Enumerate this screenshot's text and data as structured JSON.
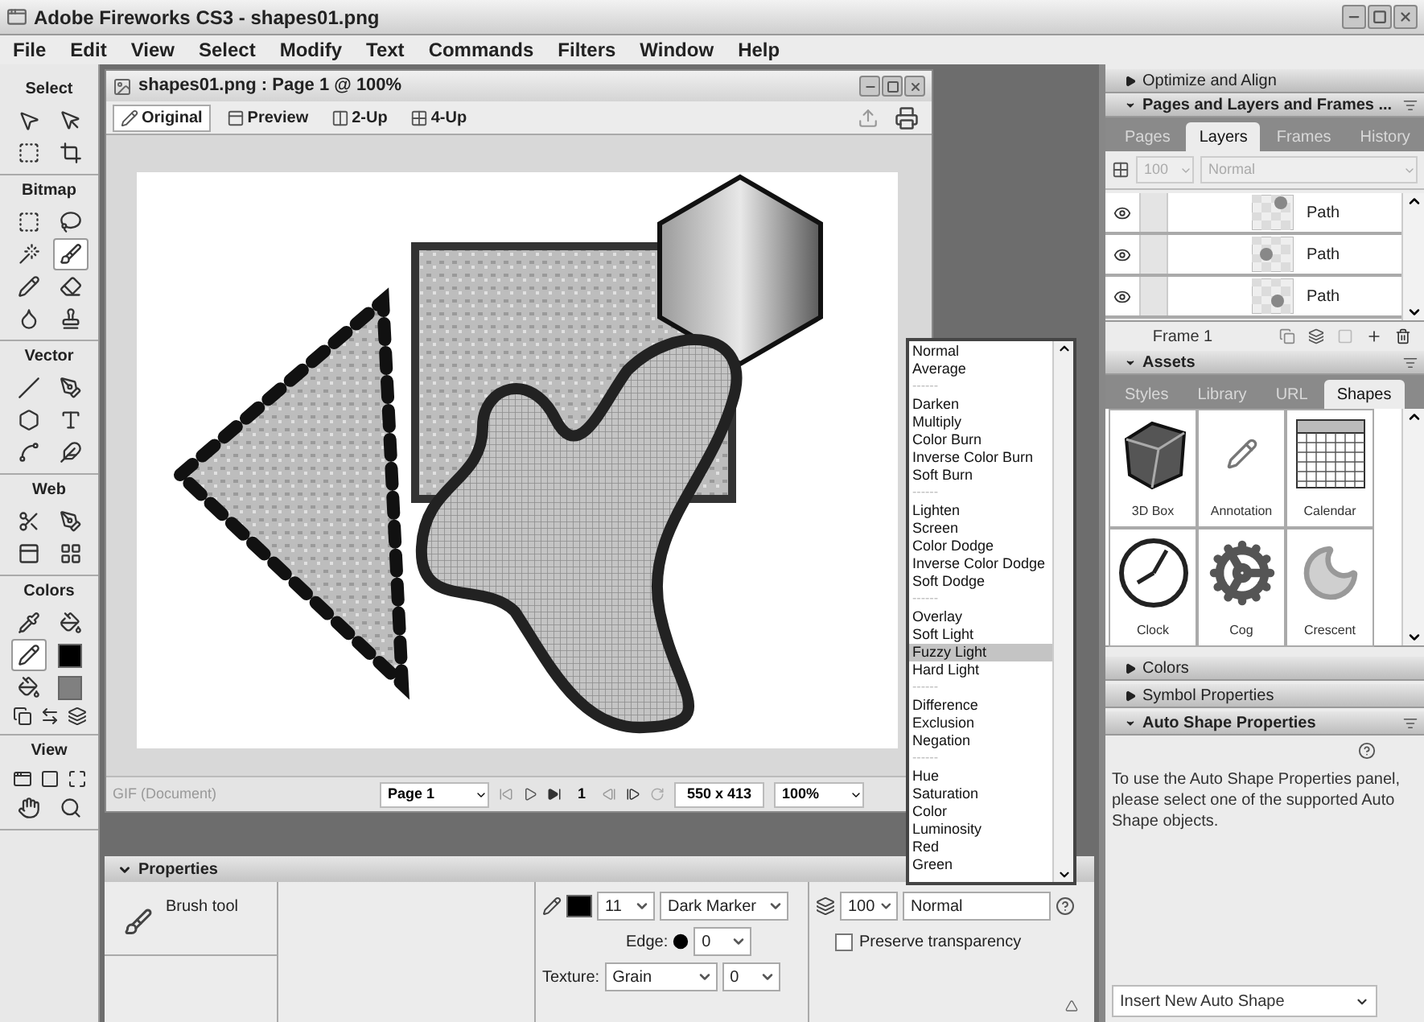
{
  "window": {
    "title": "Adobe Fireworks CS3 - shapes01.png"
  },
  "menu": [
    "File",
    "Edit",
    "View",
    "Select",
    "Modify",
    "Text",
    "Commands",
    "Filters",
    "Window",
    "Help"
  ],
  "tools_panel": [
    {
      "title": "Select",
      "tools": [
        {
          "kind": "tool",
          "selected": false
        },
        {
          "kind": "tool",
          "selected": false
        },
        {
          "kind": "tool",
          "selected": false
        },
        {
          "kind": "tool",
          "selected": false
        }
      ]
    },
    {
      "title": "Bitmap",
      "tools": [
        {
          "kind": "tool",
          "selected": false
        },
        {
          "kind": "tool",
          "selected": false
        },
        {
          "kind": "tool",
          "selected": false
        },
        {
          "kind": "tool",
          "selected": true
        },
        {
          "kind": "tool",
          "selected": false
        },
        {
          "kind": "tool",
          "selected": false
        },
        {
          "kind": "tool",
          "selected": false
        },
        {
          "kind": "tool",
          "selected": false
        }
      ]
    },
    {
      "title": "Vector",
      "tools": [
        {
          "kind": "tool",
          "selected": false
        },
        {
          "kind": "tool",
          "selected": false
        },
        {
          "kind": "tool",
          "selected": false
        },
        {
          "kind": "tool",
          "selected": false
        },
        {
          "kind": "tool",
          "selected": false
        },
        {
          "kind": "tool",
          "selected": false
        }
      ]
    },
    {
      "title": "Web",
      "tools": [
        {
          "kind": "tool",
          "selected": false
        },
        {
          "kind": "tool",
          "selected": false
        },
        {
          "kind": "tool",
          "selected": false
        },
        {
          "kind": "tool",
          "selected": false
        }
      ]
    },
    {
      "title": "Colors",
      "tools": [
        {
          "kind": "tool",
          "selected": false
        },
        {
          "kind": "tool",
          "selected": false
        },
        {
          "kind": "tool",
          "selected": true
        },
        {
          "kind": "swatch",
          "color": "#000000"
        },
        {
          "kind": "tool",
          "selected": false
        },
        {
          "kind": "swatch",
          "color": "#808080"
        },
        {
          "kind": "mini"
        },
        {
          "kind": "mini"
        },
        {
          "kind": "mini"
        }
      ]
    },
    {
      "title": "View",
      "tools": [
        {
          "kind": "mini"
        },
        {
          "kind": "mini"
        },
        {
          "kind": "mini"
        },
        {
          "kind": "tool",
          "selected": false
        },
        {
          "kind": "tool",
          "selected": false
        }
      ]
    }
  ],
  "document": {
    "title": "shapes01.png : Page 1 @ 100%",
    "view_tabs": [
      {
        "label": "Original",
        "selected": true
      },
      {
        "label": "Preview",
        "selected": false
      },
      {
        "label": "2-Up",
        "selected": false
      },
      {
        "label": "4-Up",
        "selected": false
      }
    ],
    "status": {
      "file_type": "GIF (Document)",
      "page": "Page 1",
      "frame": "1",
      "size": "550 x 413",
      "zoom": "100%"
    }
  },
  "blend_dropdown": [
    {
      "label": "Normal",
      "kind": "option",
      "selected": false
    },
    {
      "label": "Average",
      "kind": "option",
      "selected": false
    },
    {
      "label": "------",
      "kind": "separator"
    },
    {
      "label": "Darken",
      "kind": "option",
      "selected": false
    },
    {
      "label": "Multiply",
      "kind": "option",
      "selected": false
    },
    {
      "label": "Color Burn",
      "kind": "option",
      "selected": false
    },
    {
      "label": "Inverse Color Burn",
      "kind": "option",
      "selected": false
    },
    {
      "label": "Soft Burn",
      "kind": "option",
      "selected": false
    },
    {
      "label": "------",
      "kind": "separator"
    },
    {
      "label": "Lighten",
      "kind": "option",
      "selected": false
    },
    {
      "label": "Screen",
      "kind": "option",
      "selected": false
    },
    {
      "label": "Color Dodge",
      "kind": "option",
      "selected": false
    },
    {
      "label": "Inverse Color Dodge",
      "kind": "option",
      "selected": false
    },
    {
      "label": "Soft Dodge",
      "kind": "option",
      "selected": false
    },
    {
      "label": "------",
      "kind": "separator"
    },
    {
      "label": "Overlay",
      "kind": "option",
      "selected": false
    },
    {
      "label": "Soft Light",
      "kind": "option",
      "selected": false
    },
    {
      "label": "Fuzzy Light",
      "kind": "option",
      "selected": true
    },
    {
      "label": "Hard Light",
      "kind": "option",
      "selected": false
    },
    {
      "label": "------",
      "kind": "separator"
    },
    {
      "label": "Difference",
      "kind": "option",
      "selected": false
    },
    {
      "label": "Exclusion",
      "kind": "option",
      "selected": false
    },
    {
      "label": "Negation",
      "kind": "option",
      "selected": false
    },
    {
      "label": "------",
      "kind": "separator"
    },
    {
      "label": "Hue",
      "kind": "option",
      "selected": false
    },
    {
      "label": "Saturation",
      "kind": "option",
      "selected": false
    },
    {
      "label": "Color",
      "kind": "option",
      "selected": false
    },
    {
      "label": "Luminosity",
      "kind": "option",
      "selected": false
    },
    {
      "label": "Red",
      "kind": "option",
      "selected": false
    },
    {
      "label": "Green",
      "kind": "option",
      "selected": false
    }
  ],
  "properties": {
    "title": "Properties",
    "tool": "Brush tool",
    "stroke_size": "11",
    "stroke_type": "Dark Marker",
    "edge_label": "Edge:",
    "edge_value": "0",
    "texture_label": "Texture:",
    "texture": "Grain",
    "texture_amount": "0",
    "opacity": "100",
    "blend_mode": "Normal",
    "preserve_transparency": {
      "label": "Preserve transparency",
      "checked": false
    }
  },
  "right_panel": {
    "optimize": {
      "title": "Optimize and Align",
      "expanded": false
    },
    "pages_layers": {
      "title": "Pages and Layers and Frames ...",
      "expanded": true,
      "tabs": [
        {
          "label": "Pages",
          "selected": false
        },
        {
          "label": "Layers",
          "selected": true
        },
        {
          "label": "Frames",
          "selected": false
        },
        {
          "label": "History",
          "selected": false
        }
      ],
      "opacity": "100",
      "blend": "Normal",
      "layers": [
        {
          "name": "Path"
        },
        {
          "name": "Path"
        },
        {
          "name": "Path"
        }
      ],
      "frame": "Frame 1"
    },
    "assets": {
      "title": "Assets",
      "expanded": true,
      "tabs": [
        {
          "label": "Styles",
          "selected": false
        },
        {
          "label": "Library",
          "selected": false
        },
        {
          "label": "URL",
          "selected": false
        },
        {
          "label": "Shapes",
          "selected": true
        }
      ],
      "shapes": [
        {
          "name": "3D Box"
        },
        {
          "name": "Annotation"
        },
        {
          "name": "Calendar"
        },
        {
          "name": "Clock"
        },
        {
          "name": "Cog"
        },
        {
          "name": "Crescent"
        }
      ]
    },
    "colors": {
      "title": "Colors",
      "expanded": false
    },
    "symbol": {
      "title": "Symbol Properties",
      "expanded": false
    },
    "auto_shape": {
      "title": "Auto Shape Properties",
      "expanded": true,
      "message": "To use the Auto Shape Properties panel, please select one of the supported Auto Shape objects.",
      "insert": "Insert New Auto Shape"
    }
  }
}
